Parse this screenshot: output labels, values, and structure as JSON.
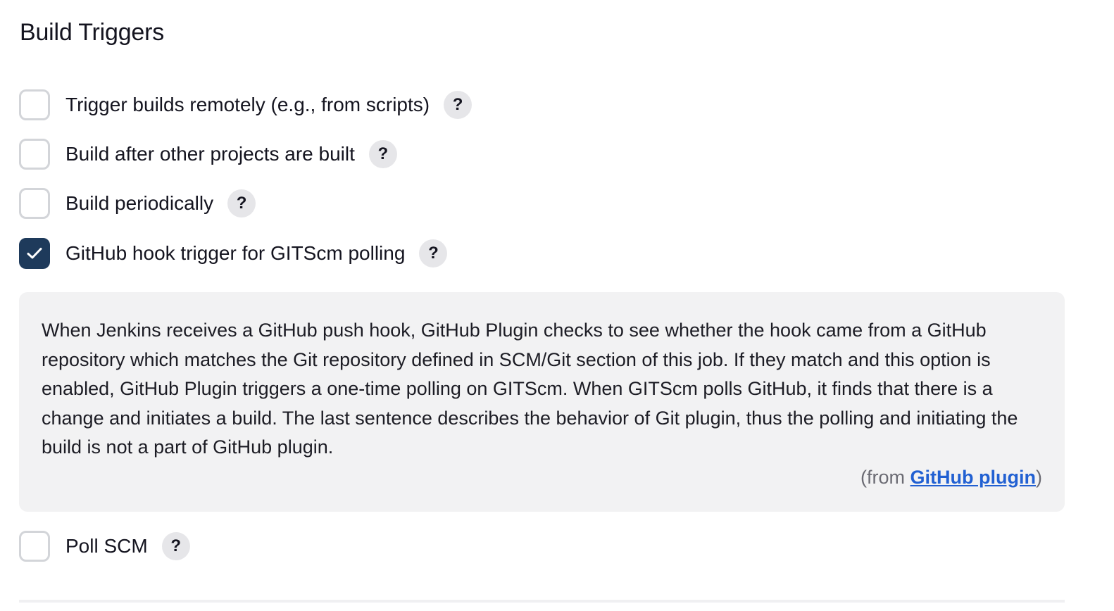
{
  "section": {
    "title": "Build Triggers"
  },
  "triggers": [
    {
      "label": "Trigger builds remotely (e.g., from scripts)",
      "checked": false,
      "help": "?"
    },
    {
      "label": "Build after other projects are built",
      "checked": false,
      "help": "?"
    },
    {
      "label": "Build periodically",
      "checked": false,
      "help": "?"
    },
    {
      "label": "GitHub hook trigger for GITScm polling",
      "checked": true,
      "help": "?"
    },
    {
      "label": "Poll SCM",
      "checked": false,
      "help": "?"
    }
  ],
  "help_panel": {
    "text": "When Jenkins receives a GitHub push hook, GitHub Plugin checks to see whether the hook came from a GitHub repository which matches the Git repository defined in SCM/Git section of this job. If they match and this option is enabled, GitHub Plugin triggers a one-time polling on GITScm. When GITScm polls GitHub, it finds that there is a change and initiates a build. The last sentence describes the behavior of Git plugin, thus the polling and initiating the build is not a part of GitHub plugin.",
    "source_prefix": "(from ",
    "source_link": "GitHub plugin",
    "source_suffix": ")"
  },
  "colors": {
    "checkbox_checked": "#1e3a5b",
    "checkbox_border": "#d3d5d9",
    "help_bg": "#f2f2f3",
    "link": "#2160d2"
  }
}
